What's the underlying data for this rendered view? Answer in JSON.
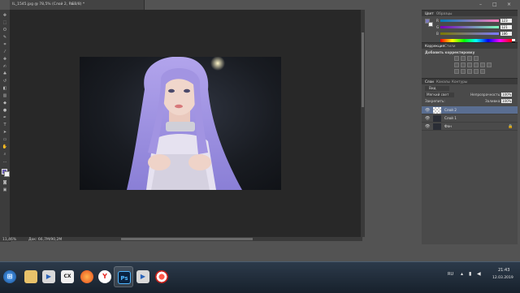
{
  "document": {
    "tab_title": "IL_1545.jpg @ 78,5% (Слой 2, RGB/8) *",
    "close_symbol": "×"
  },
  "window_controls": [
    "–",
    "□",
    "×"
  ],
  "status_bar": {
    "zoom": "11,46%",
    "doc_size": "Док: 66,7M/90,2M"
  },
  "panels": {
    "color": {
      "tabs": [
        "Цвет",
        "Образцы"
      ],
      "channels": [
        {
          "label": "R",
          "value": "123"
        },
        {
          "label": "G",
          "value": "121"
        },
        {
          "label": "B",
          "value": "186"
        }
      ],
      "foreground_color": "#7b79ba"
    },
    "adjustments": {
      "tabs": [
        "Коррекция",
        "Стили"
      ],
      "title": "Добавить корректировку"
    },
    "layers": {
      "tabs": [
        "Слои",
        "Каналы",
        "Контуры"
      ],
      "kind_label": "Вид",
      "blend_mode": "Мягкий свет",
      "opacity_label": "Непрозрачность:",
      "opacity_value": "100%",
      "lock_label": "Закрепить:",
      "fill_label": "Заливка:",
      "fill_value": "100%",
      "layers": [
        {
          "name": "Слой 2",
          "selected": true
        },
        {
          "name": "Слой 1",
          "selected": false
        },
        {
          "name": "Фон",
          "selected": false
        }
      ]
    }
  },
  "taskbar": {
    "apps": [
      "start",
      "explorer",
      "media-player",
      "cx",
      "firefox",
      "yandex-browser",
      "photoshop",
      "media-player-2",
      "recorder"
    ],
    "photoshop_label": "Ps",
    "cx_label": "CX",
    "language": "RU",
    "time": "21:43",
    "date": "12.03.2019"
  },
  "colors": {
    "workspace": "#535353",
    "canvas_bg": "#282828",
    "selected_layer": "#5a6e91",
    "wig": "#a99be0"
  }
}
